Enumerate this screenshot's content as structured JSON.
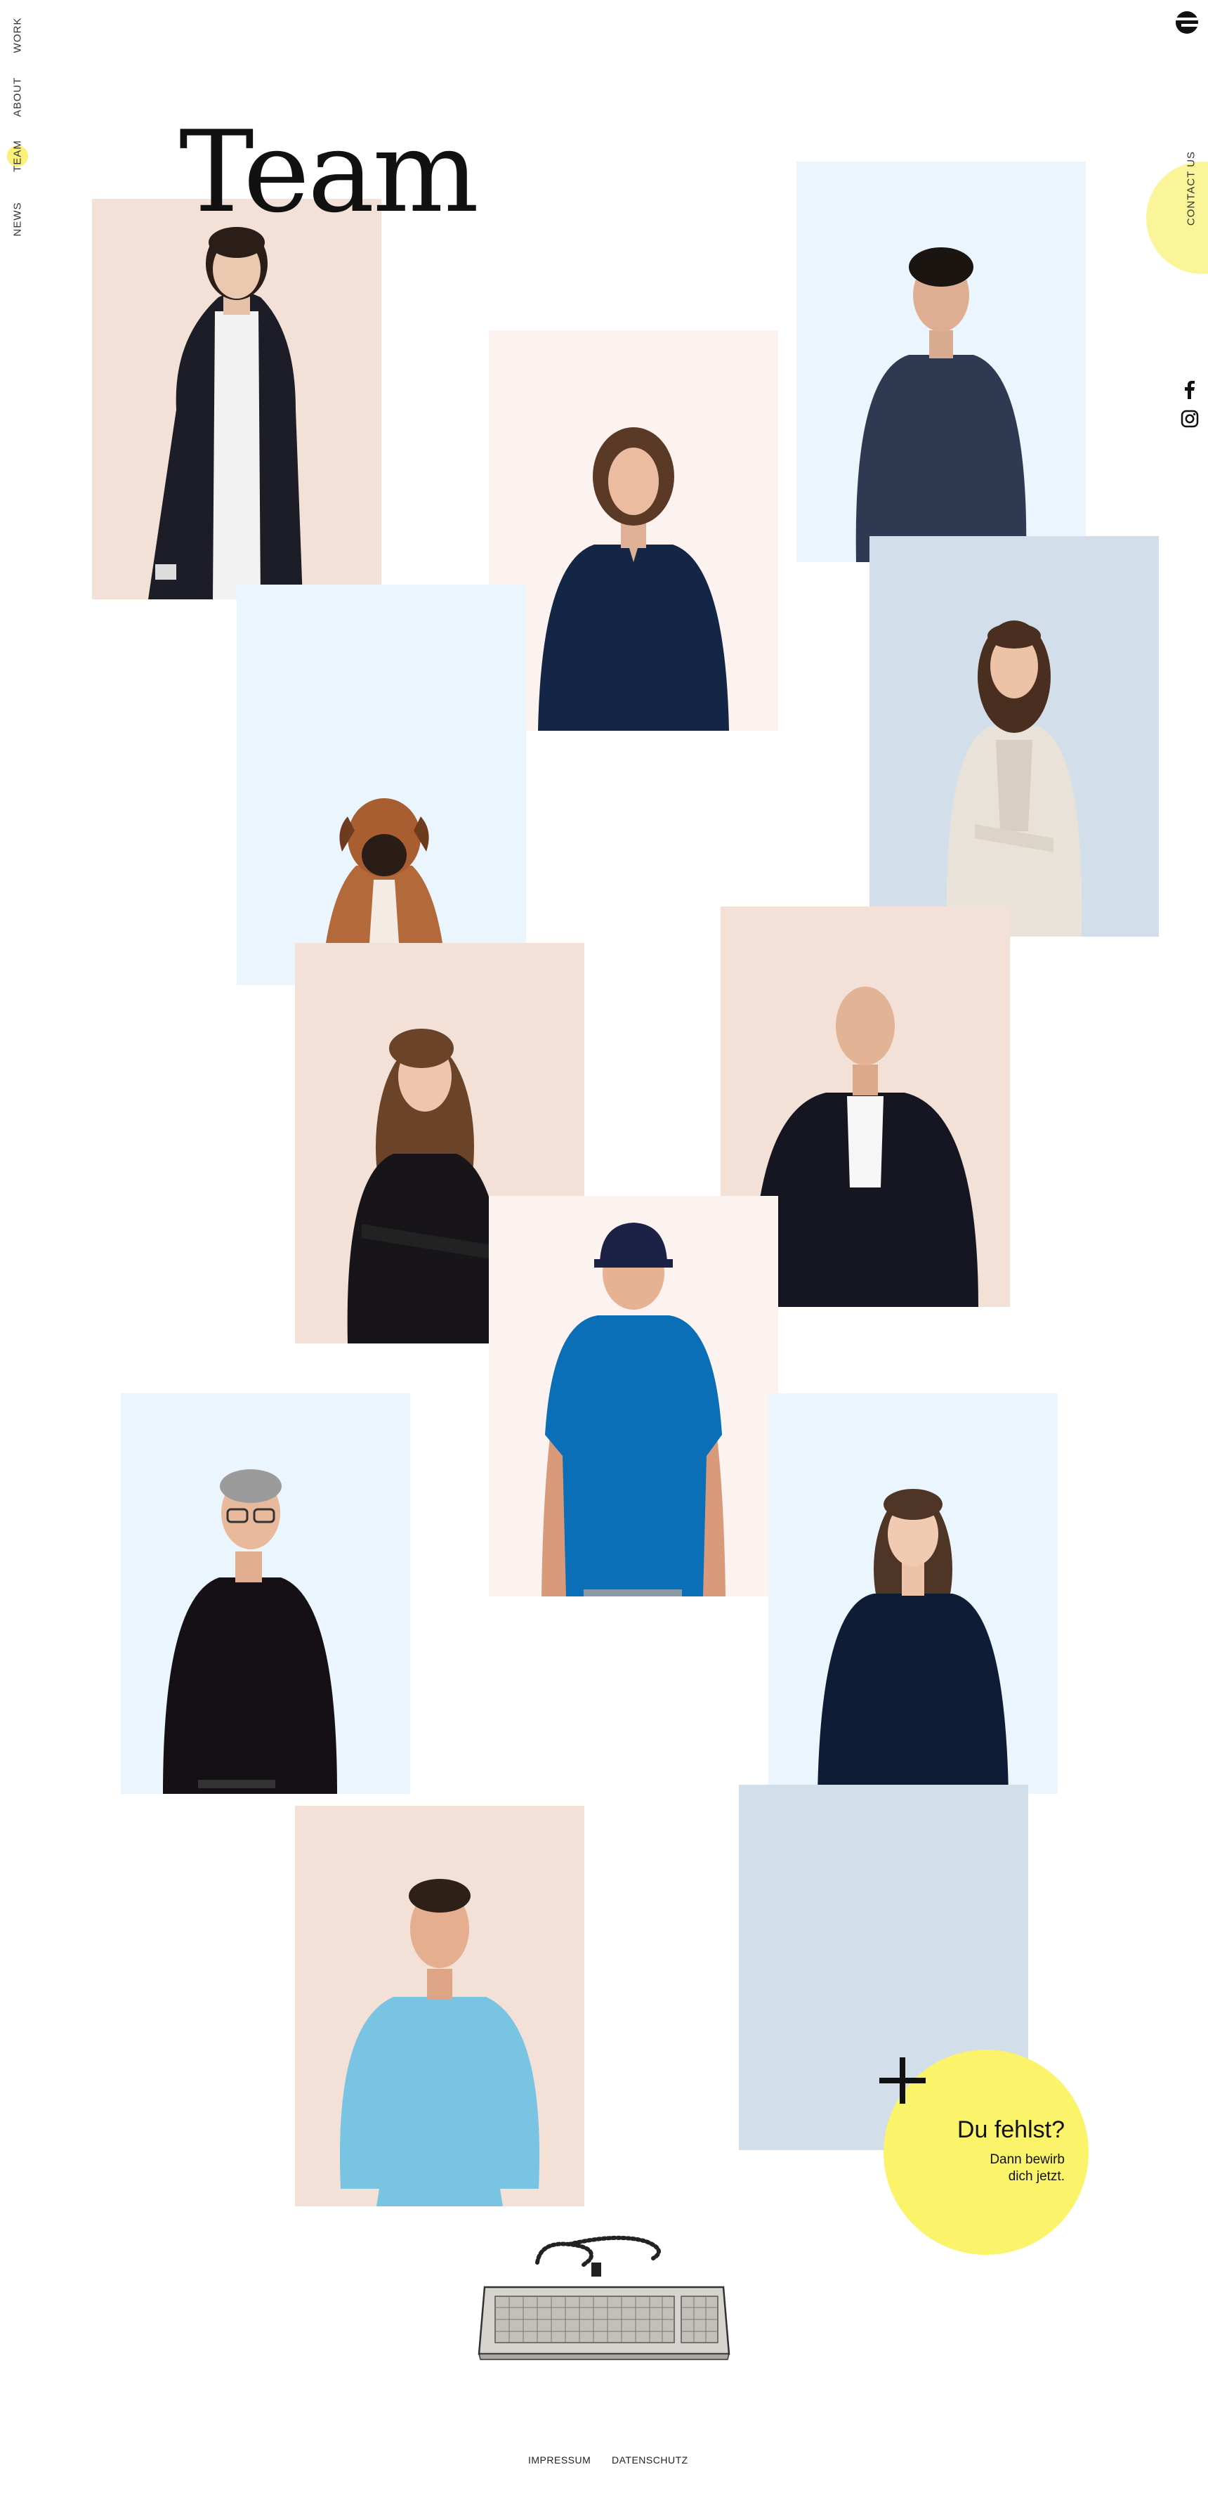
{
  "nav": {
    "work": "WORK",
    "about": "ABOUT",
    "team": "TEAM",
    "news": "NEWS"
  },
  "contact": {
    "label": "CONTACT US"
  },
  "title": "Team",
  "cta": {
    "title": "Du fehlst?",
    "line1": "Dann bewirb",
    "line2": "dich jetzt."
  },
  "footer": {
    "impressum": "IMPRESSUM",
    "datenschutz": "DATENSCHUTZ"
  },
  "colors": {
    "accent_yellow": "#fbf46a",
    "peach": "#f3e1d8",
    "blush": "#fcf3f1",
    "sky": "#eaf5fd",
    "steel": "#d2dee9"
  },
  "icons": [
    "logo-icon",
    "facebook-icon",
    "instagram-icon",
    "keyboard-illustration"
  ]
}
